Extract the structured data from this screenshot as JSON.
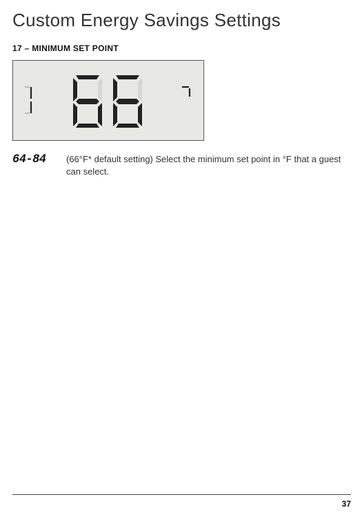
{
  "page_title": "Custom Energy Savings Settings",
  "section_heading": "17 – MINIMUM SET POINT",
  "lcd": {
    "left_segment": "17-left",
    "center_value": "66",
    "right_segment": "17-right"
  },
  "range_label": "64-84",
  "description": "(66°F* default setting) Select the minimum set point in °F that a guest can select.",
  "page_number": "37"
}
